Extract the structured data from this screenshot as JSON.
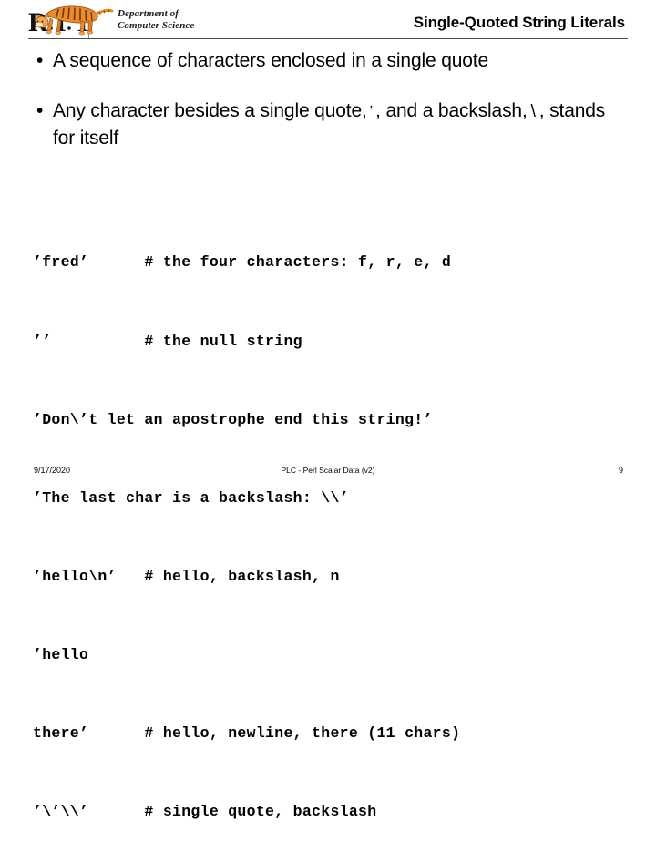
{
  "header": {
    "logo": {
      "institution_letters": "R.I.T",
      "icon": "rit-tiger-logo",
      "dept_line1": "Department of",
      "dept_line2": "Computer Science"
    },
    "title": "Single-Quoted String Literals"
  },
  "bullets": [
    {
      "marker": "•",
      "segments": [
        {
          "type": "text",
          "value": "A sequence of characters enclosed in a single quote"
        }
      ],
      "plain": "A sequence of characters enclosed in a single quote"
    },
    {
      "marker": "•",
      "segments": [
        {
          "type": "text",
          "value": "Any character besides a single quote,"
        },
        {
          "type": "quote",
          "value": "’"
        },
        {
          "type": "text",
          "value": ", and a backslash,"
        },
        {
          "type": "backslash",
          "value": "\\"
        },
        {
          "type": "text",
          "value": ", stands for itself"
        }
      ],
      "plain": "Any character besides a single quote, ’ , and a backslash, \\ , stands for itself"
    }
  ],
  "code": {
    "lines": [
      "’fred’      # the four characters: f, r, e, d",
      "’’          # the null string",
      "’Don\\’t let an apostrophe end this string!’",
      "’The last char is a backslash: \\\\’",
      "’hello\\n’   # hello, backslash, n",
      "’hello",
      "there’      # hello, newline, there (11 chars)",
      "’\\’\\\\’      # single quote, backslash"
    ]
  },
  "footer": {
    "date": "9/17/2020",
    "center": "PLC - Perl Scalar Data (v2)",
    "page": "9"
  },
  "colors": {
    "text": "#000000",
    "rule": "#4a4a4a",
    "tiger_orange": "#e8862a",
    "tiger_light": "#f3c276"
  }
}
